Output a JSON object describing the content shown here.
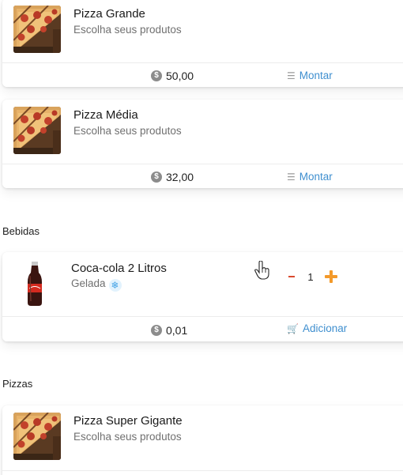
{
  "products": [
    {
      "title": "Pizza Grande",
      "subtitle": "Escolha seus produtos",
      "price": "50,00",
      "action": "Montar",
      "image": "pizza"
    },
    {
      "title": "Pizza Média",
      "subtitle": "Escolha seus produtos",
      "price": "32,00",
      "action": "Montar",
      "image": "pizza"
    }
  ],
  "sections": {
    "bebidas": "Bebidas",
    "pizzas": "Pizzas"
  },
  "drink": {
    "title": "Coca-cola 2 Litros",
    "subtitle": "Gelada",
    "tag_icon": "snowflake-icon",
    "price": "0,01",
    "quantity": "1",
    "action": "Adicionar",
    "image": "soda-bottle"
  },
  "bottom_product": {
    "title": "Pizza Super Gigante",
    "subtitle": "Escolha seus produtos",
    "image": "pizza"
  },
  "icons": {
    "price": "coin-icon",
    "montar": "list-icon",
    "adicionar": "cart-icon",
    "cursor": "hand-pointer-icon"
  },
  "colors": {
    "link": "#3f8fcf",
    "minus": "#d94a2e",
    "plus": "#f39a2b",
    "snow_bg": "#e2f2fd"
  }
}
